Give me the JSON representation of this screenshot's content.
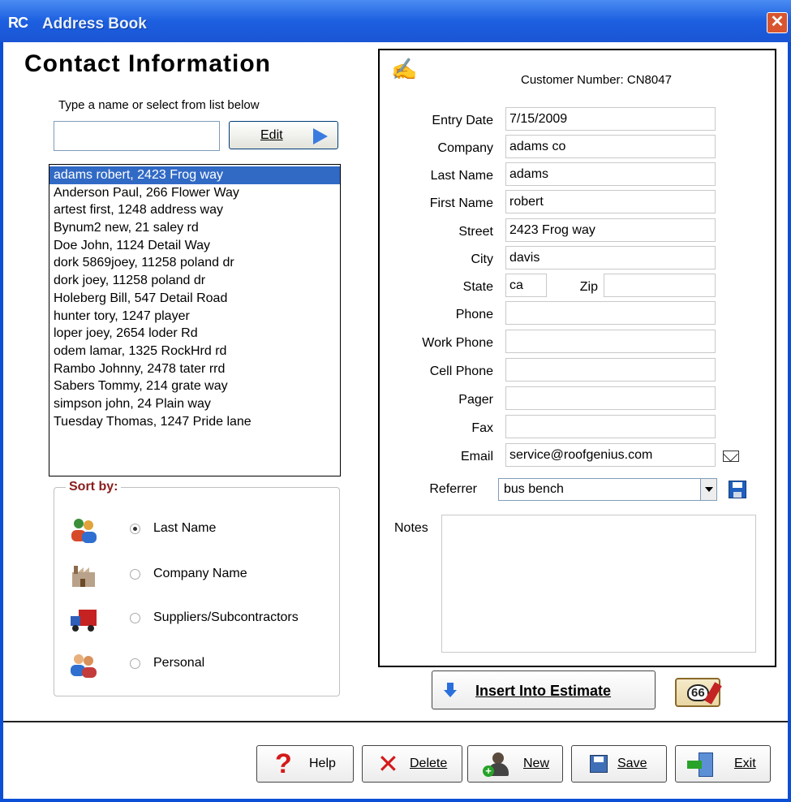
{
  "window": {
    "title": "Address Book",
    "app_badge": "RC",
    "close_glyph": "✕"
  },
  "left": {
    "heading": "Contact Information",
    "hint": "Type a name or select from list below",
    "search_value": "",
    "edit_label": "Edit",
    "contacts": [
      "adams robert, 2423 Frog way",
      "Anderson Paul, 266 Flower Way",
      "artest first, 1248 address way",
      "Bynum2 new, 21 saley rd",
      "Doe John, 1124 Detail Way",
      "dork 5869joey, 11258 poland dr",
      "dork joey, 11258 poland dr",
      "Holeberg Bill, 547 Detail Road",
      "hunter tory, 1247 player",
      "loper joey, 2654 loder Rd",
      "odem lamar, 1325 RockHrd rd",
      "Rambo Johnny, 2478 tater rrd",
      "Sabers Tommy, 214 grate way",
      "simpson john, 24 Plain way",
      "Tuesday Thomas, 1247 Pride lane"
    ],
    "selected_index": 0,
    "sort": {
      "legend": "Sort by:",
      "options": [
        {
          "label": "Last Name",
          "icon": "contacts-group-icon",
          "checked": true
        },
        {
          "label": "Company Name",
          "icon": "factory-icon",
          "checked": false
        },
        {
          "label": "Suppliers/Subcontractors",
          "icon": "truck-icon",
          "checked": false
        },
        {
          "label": "Personal",
          "icon": "people-icon",
          "checked": false
        }
      ]
    }
  },
  "form": {
    "customer_number_label": "Customer Number:",
    "customer_number": "CN8047",
    "labels": {
      "entry_date": "Entry Date",
      "company": "Company",
      "last_name": "Last Name",
      "first_name": "First Name",
      "street": "Street",
      "city": "City",
      "state": "State",
      "zip": "Zip",
      "phone": "Phone",
      "work_phone": "Work Phone",
      "cell_phone": "Cell Phone",
      "pager": "Pager",
      "fax": "Fax",
      "email": "Email",
      "referrer": "Referrer",
      "notes": "Notes"
    },
    "values": {
      "entry_date": "7/15/2009",
      "company": "adams co",
      "last_name": "adams",
      "first_name": "robert",
      "street": "2423 Frog way",
      "city": "davis",
      "state": "ca",
      "zip": "",
      "phone": "",
      "work_phone": "",
      "cell_phone": "",
      "pager": "",
      "fax": "",
      "email": "service@roofgenius.com",
      "referrer": "bus bench",
      "notes": ""
    }
  },
  "actions": {
    "insert_label": "Insert Into Estimate",
    "route_badge": "66",
    "help": "Help",
    "delete": "Delete",
    "new": "New",
    "save": "Save",
    "exit": "Exit"
  },
  "colors": {
    "title_bar": "#1c5fe0",
    "selection": "#316ac5",
    "sort_legend": "#8b1c1c",
    "alert_red": "#d41a1a"
  }
}
